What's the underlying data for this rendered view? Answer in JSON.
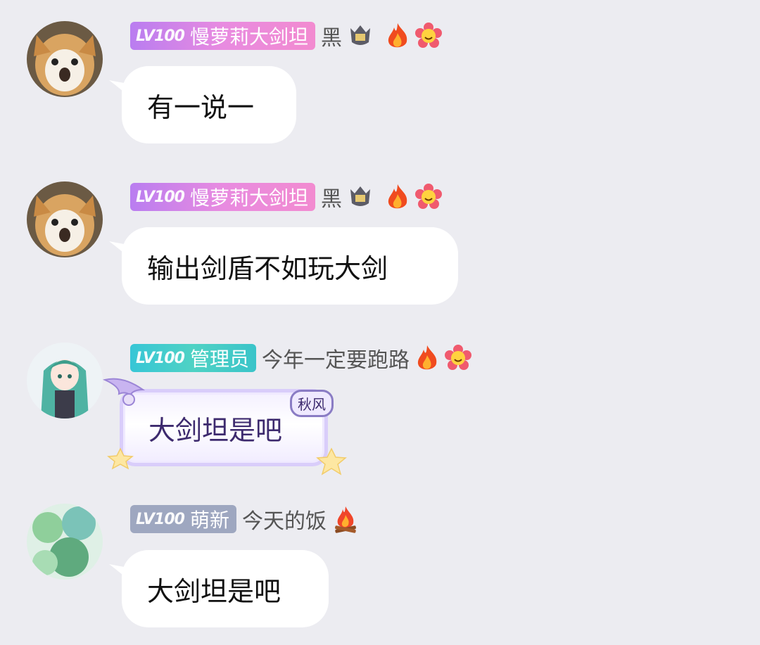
{
  "messages": [
    {
      "level": "LV100",
      "badge": "慢萝莉大剑坦",
      "title": "黑",
      "text": "有一说一"
    },
    {
      "level": "LV100",
      "badge": "慢萝莉大剑坦",
      "title": "黑",
      "text": "输出剑盾不如玩大剑"
    },
    {
      "level": "LV100",
      "badge": "管理员",
      "title": "今年一定要跑路",
      "text": "大剑坦是吧",
      "tag": "秋风"
    },
    {
      "level": "LV100",
      "badge": "萌新",
      "title": "今天的饭",
      "text": "大剑坦是吧"
    }
  ],
  "icons": {
    "rank": "rank-shield-icon",
    "fire": "fire-icon",
    "flower": "smiley-flower-icon",
    "campfire": "campfire-icon",
    "wings": "wing-icon",
    "star": "star-icon"
  }
}
